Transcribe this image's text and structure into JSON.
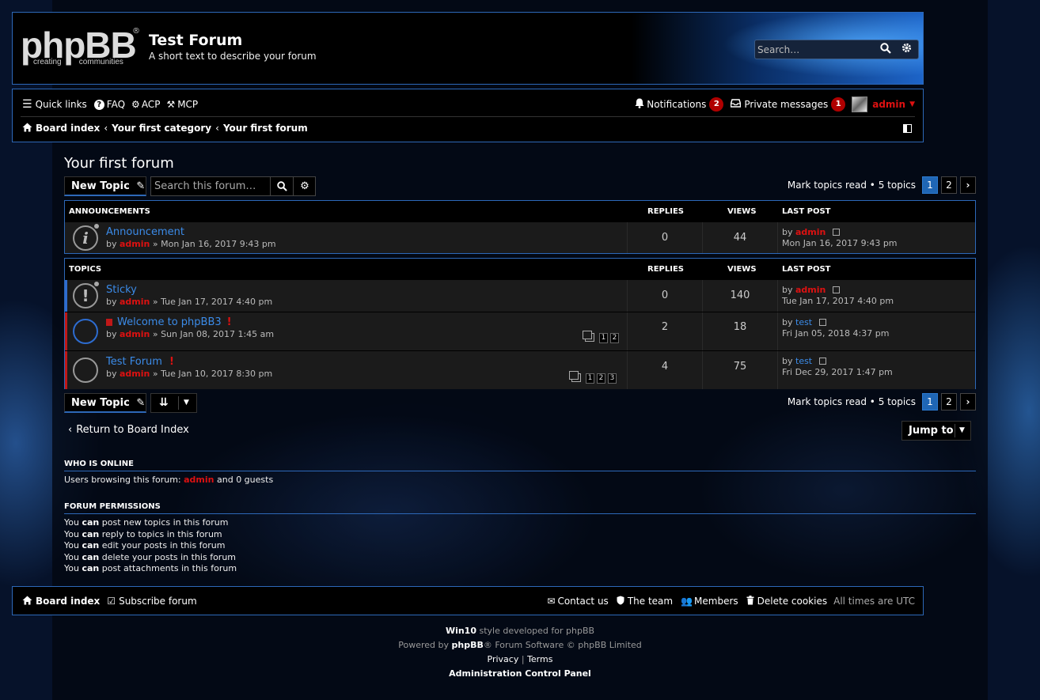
{
  "header": {
    "logo_text": "phpBB",
    "logo_reg": "®",
    "logo_sub": "creating        communities",
    "site_title": "Test Forum",
    "site_description": "A short text to describe your forum",
    "search_placeholder": "Search…"
  },
  "navbar": {
    "quick_links": "Quick links",
    "faq": "FAQ",
    "acp": "ACP",
    "mcp": "MCP",
    "notifications": "Notifications",
    "notifications_count": "2",
    "private_messages": "Private messages",
    "pm_count": "1",
    "username": "admin",
    "breadcrumbs": [
      "Board index",
      "Your first category",
      "Your first forum"
    ]
  },
  "forum": {
    "title": "Your first forum",
    "new_topic": "New Topic",
    "search_placeholder": "Search this forum…",
    "mark_read": "Mark topics read",
    "topic_count": "5 topics",
    "pages": [
      "1",
      "2"
    ],
    "current_page": "1"
  },
  "announcements": {
    "heading": "Announcements",
    "col_replies": "Replies",
    "col_views": "Views",
    "col_last_post": "Last post",
    "rows": [
      {
        "title": "Announcement",
        "by": "by",
        "author": "admin",
        "date": "» Mon Jan 16, 2017 9:43 pm",
        "replies": "0",
        "views": "44",
        "lp_by": "by",
        "lp_author": "admin",
        "lp_date": "Mon Jan 16, 2017 9:43 pm"
      }
    ]
  },
  "topics": {
    "heading": "Topics",
    "col_replies": "Replies",
    "col_views": "Views",
    "col_last_post": "Last post",
    "rows": [
      {
        "title": "Sticky",
        "by": "by",
        "author": "admin",
        "date": "» Tue Jan 17, 2017 4:40 pm",
        "replies": "0",
        "views": "140",
        "lp_by": "by",
        "lp_author": "admin",
        "lp_date": "Tue Jan 17, 2017 4:40 pm"
      },
      {
        "title": "Welcome to phpBB3",
        "by": "by",
        "author": "admin",
        "date": "» Sun Jan 08, 2017 1:45 am",
        "replies": "2",
        "views": "18",
        "lp_by": "by",
        "lp_author": "test",
        "lp_date": "Fri Jan 05, 2018 4:37 pm",
        "pages": [
          "1",
          "2"
        ]
      },
      {
        "title": "Test Forum",
        "by": "by",
        "author": "admin",
        "date": "» Tue Jan 10, 2017 8:30 pm",
        "replies": "4",
        "views": "75",
        "lp_by": "by",
        "lp_author": "test",
        "lp_date": "Fri Dec 29, 2017 1:47 pm",
        "pages": [
          "1",
          "2",
          "3"
        ]
      }
    ]
  },
  "actions": {
    "return_label": "Return to Board Index",
    "jump_to": "Jump to"
  },
  "online": {
    "heading": "Who is online",
    "text_before": "Users browsing this forum:",
    "user": "admin",
    "text_after": "and 0 guests"
  },
  "permissions": {
    "heading": "Forum permissions",
    "lines": [
      {
        "pre": "You",
        "can": "can",
        "rest": "post new topics in this forum"
      },
      {
        "pre": "You",
        "can": "can",
        "rest": "reply to topics in this forum"
      },
      {
        "pre": "You",
        "can": "can",
        "rest": "edit your posts in this forum"
      },
      {
        "pre": "You",
        "can": "can",
        "rest": "delete your posts in this forum"
      },
      {
        "pre": "You",
        "can": "can",
        "rest": "post attachments in this forum"
      }
    ]
  },
  "footer": {
    "board_index": "Board index",
    "subscribe": "Subscribe forum",
    "contact": "Contact us",
    "team": "The team",
    "members": "Members",
    "delete_cookies": "Delete cookies",
    "timezone": "All times are UTC"
  },
  "credits": {
    "style_name": "Win10",
    "style_text": "style developed for phpBB",
    "powered_pre": "Powered by",
    "powered_brand": "phpBB",
    "powered_post": "® Forum Software © phpBB Limited",
    "privacy": "Privacy",
    "sep": "|",
    "terms": "Terms",
    "acp": "Administration Control Panel"
  },
  "colors": {
    "accent": "#2d68b8",
    "link": "#3b8be8",
    "admin": "#dd1111",
    "badge": "#b00000"
  }
}
